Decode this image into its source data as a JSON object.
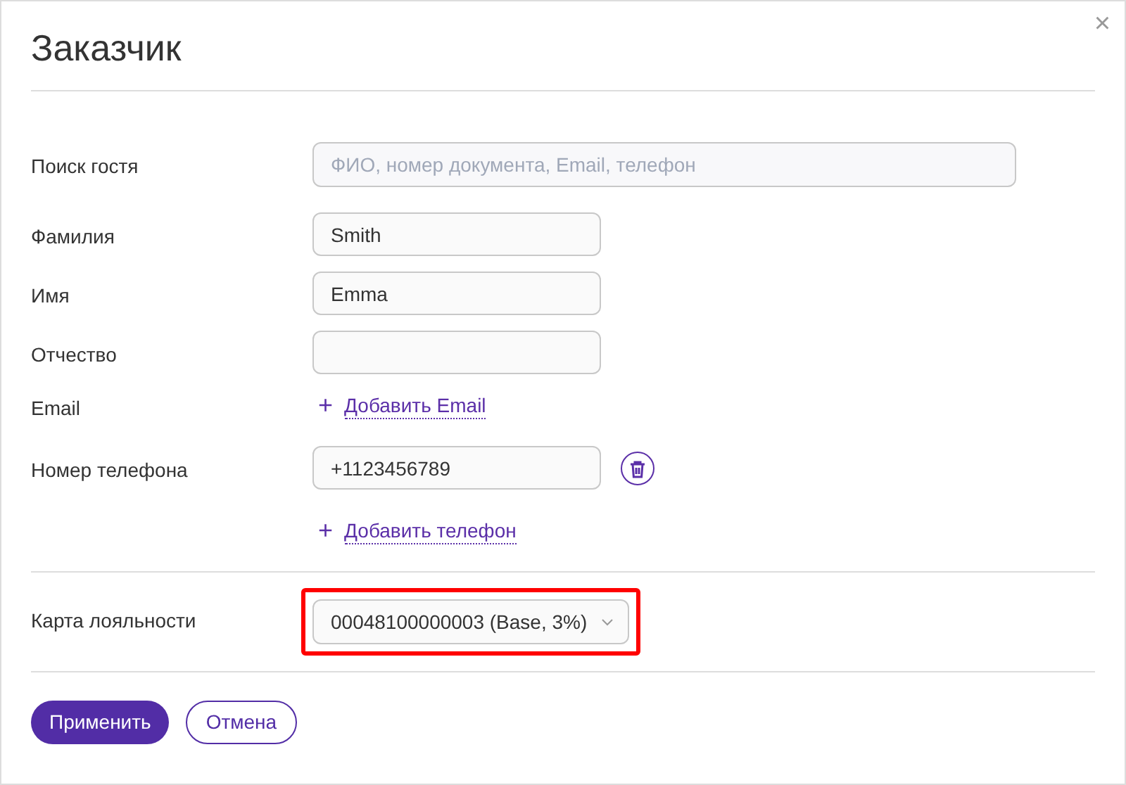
{
  "dialog": {
    "title": "Заказчик",
    "close": "×"
  },
  "rows": [
    {
      "kind": "search",
      "label": "Поиск гостя",
      "placeholder": "ФИО, номер документа, Email, телефон"
    },
    {
      "kind": "text",
      "label": "Фамилия",
      "value": "Smith"
    },
    {
      "kind": "text",
      "label": "Имя",
      "value": "Emma"
    },
    {
      "kind": "text",
      "label": "Отчество"
    },
    {
      "kind": "add",
      "label": "Email",
      "plus": "+",
      "link": "Добавить Email"
    },
    {
      "kind": "phone",
      "label": "Номер телефона",
      "value": "+1123456789"
    },
    {
      "kind": "add",
      "plus": "+",
      "link": "Добавить телефон"
    }
  ],
  "loyalty": {
    "label": "Карта лояльности",
    "value": "00048100000003 (Base, 3%)",
    "highlighted": true
  },
  "buttons": [
    {
      "kind": "primary",
      "label": "Применить"
    },
    {
      "kind": "secondary",
      "label": "Отмена"
    }
  ]
}
